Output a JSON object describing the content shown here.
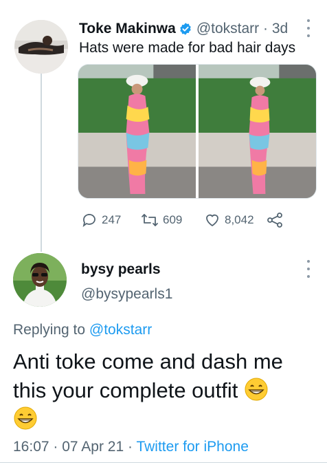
{
  "parent_tweet": {
    "author_name": "Toke Makinwa",
    "handle": "@tokstarr",
    "separator": "·",
    "age": "3d",
    "text": "Hats were made for bad hair days",
    "reply_count": "247",
    "retweet_count": "609",
    "like_count": "8,042"
  },
  "reply_tweet": {
    "author_name": "bysy pearls",
    "handle": "@bysypearls1",
    "replying_prefix": "Replying to",
    "replying_to": "@tokstarr",
    "text_line1": "Anti toke come and dash me",
    "text_line2": "this your complete outfit",
    "time": "16:07",
    "dot": "·",
    "date": "07 Apr 21",
    "source": "Twitter for iPhone"
  },
  "colors": {
    "primary_text": "#0f1419",
    "secondary_text": "#536471",
    "link_blue": "#1d9bf0",
    "verified_blue": "#1d9bf0"
  },
  "icons": [
    "verified-badge-icon",
    "more-icon",
    "reply-icon",
    "retweet-icon",
    "like-icon",
    "share-icon",
    "grinning-emoji-icon"
  ]
}
